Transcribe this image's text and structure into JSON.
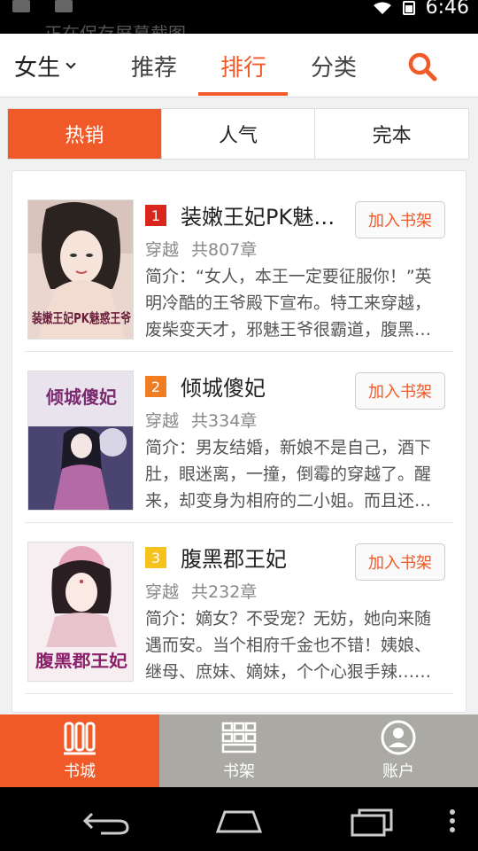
{
  "status_bar": {
    "notification_text": "正在保存屏幕截图...",
    "time": "6:46"
  },
  "top_nav": {
    "gender_label": "女生",
    "tabs": [
      "推荐",
      "排行",
      "分类"
    ],
    "active_tab": "排行"
  },
  "segments": [
    "热销",
    "人气",
    "完本"
  ],
  "books": [
    {
      "rank": "1",
      "title": "装嫩王妃PK魅惑王爷",
      "category": "穿越",
      "chapters": "共807章",
      "description": "简介：“女人，本王一定要征服你！”英明冷酷的王爷殿下宣布。特工来穿越，废柴变天才，邪魅王爷很霸道，腹黑王妃更强悍……",
      "add_label": "加入书架",
      "cover_text": "装嫩王妃PK魅惑王爷"
    },
    {
      "rank": "2",
      "title": "倾城傻妃",
      "category": "穿越",
      "chapters": "共334章",
      "description": "简介：男友结婚，新娘不是自己，酒下肚，眼迷离，一撞，倒霉的穿越了。醒来，却变身为相府的二小姐。而且还是个傻子……",
      "add_label": "加入书架",
      "cover_text": "倾城傻妃"
    },
    {
      "rank": "3",
      "title": "腹黑郡王妃",
      "category": "穿越",
      "chapters": "共232章",
      "description": "简介：嫡女？不受宠？无妨，她向来随遇而安。当个相府千金也不错！姨娘、继母、庶妹、嫡妹，个个心狠手辣……",
      "add_label": "加入书架",
      "cover_text": "腹黑郡王妃"
    }
  ],
  "bottom_tabs": [
    "书城",
    "书架",
    "账户"
  ],
  "colors": {
    "accent": "#f05a28",
    "tabbar": "#aaa9a4",
    "rank1": "#d9261c",
    "rank2": "#f07d22",
    "rank3": "#f6c21c"
  }
}
